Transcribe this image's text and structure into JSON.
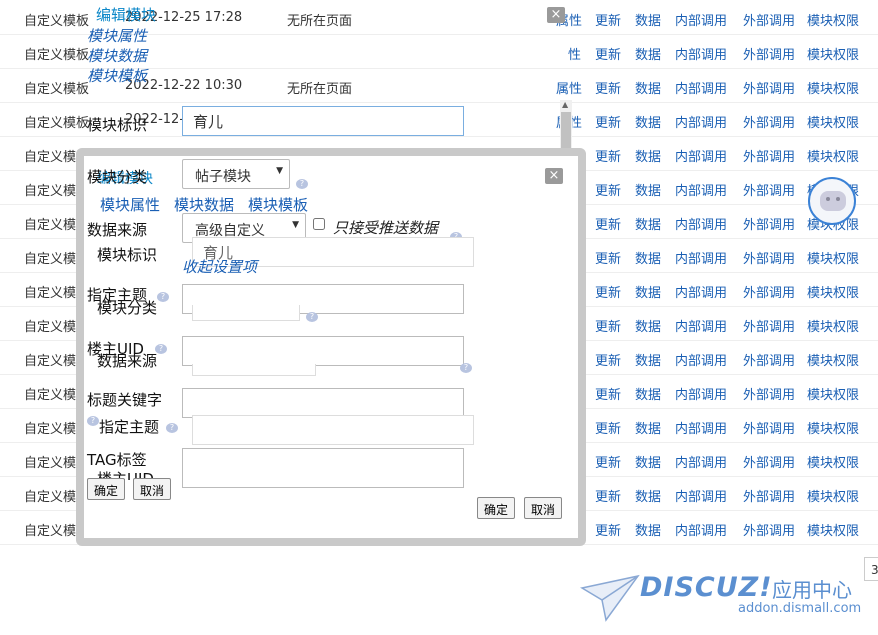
{
  "background_table": {
    "rows": [
      {
        "name": "自定义模板",
        "time": "2022-12-25 17:28",
        "desc": "无所在页面"
      },
      {
        "name": "自定义模板",
        "time": "",
        "desc": ""
      },
      {
        "name": "自定义模板",
        "time": "2022-12-22 10:30",
        "desc": "无所在页面"
      },
      {
        "name": "自定义模板",
        "time": "2022-12-",
        "desc": ""
      },
      {
        "name": "自定义模",
        "time": "",
        "desc": ""
      },
      {
        "name": "自定义模",
        "time": "",
        "desc": ""
      },
      {
        "name": "自定义模",
        "time": "",
        "desc": ""
      },
      {
        "name": "自定义模",
        "time": "",
        "desc": ""
      },
      {
        "name": "自定义模",
        "time": "",
        "desc": ""
      },
      {
        "name": "自定义模",
        "time": "",
        "desc": ""
      },
      {
        "name": "自定义模",
        "time": "",
        "desc": ""
      },
      {
        "name": "自定义模",
        "time": "",
        "desc": ""
      },
      {
        "name": "自定义模",
        "time": "",
        "desc": ""
      },
      {
        "name": "自定义模",
        "time": "",
        "desc": ""
      },
      {
        "name": "自定义模",
        "time": "",
        "desc": ""
      },
      {
        "name": "自定义模",
        "time": "",
        "desc": ""
      }
    ],
    "actions": [
      "属性",
      "更新",
      "数据",
      "内部调用",
      "外部调用",
      "模块权限"
    ],
    "actions_short": [
      "性",
      "更新",
      "数据",
      "内部调用",
      "外部调用",
      "模块权限"
    ]
  },
  "menu_back": {
    "edit": "编辑模块",
    "props": "模块属性",
    "data": "模块数据",
    "template": "模块模板"
  },
  "dialog_back": {
    "label_ident": "模块标识",
    "ident_value": "育儿",
    "label_category": "模块分类",
    "label_source": "数据来源",
    "label_topic": "指定主题",
    "label_uid": "楼主UID",
    "confirm": "确定",
    "cancel": "取消"
  },
  "dialog_front": {
    "tabs": [
      "编辑模块",
      "模块属性",
      "模块数据",
      "模块模板"
    ],
    "label_category": "模块分类",
    "category_value": "帖子模块",
    "label_source": "数据来源",
    "source_value": "高级自定义",
    "push_only_label": "只接受推送数据",
    "collapse_link": "收起设置项",
    "label_topic": "指定主题",
    "label_uid": "楼主UID",
    "label_keyword": "标题关键字",
    "label_tag": "TAG标签",
    "confirm": "确定",
    "cancel": "取消",
    "help": "?",
    "close": "×"
  },
  "watermark": {
    "brand": "DISCUZ!",
    "suffix": "应用中心",
    "site": "addon.dismall.com"
  },
  "page_indicator": "3",
  "colors": {
    "link": "#1a5fb4",
    "dialog_border": "#c9c9c9",
    "watermark": "#5b8fd0"
  }
}
